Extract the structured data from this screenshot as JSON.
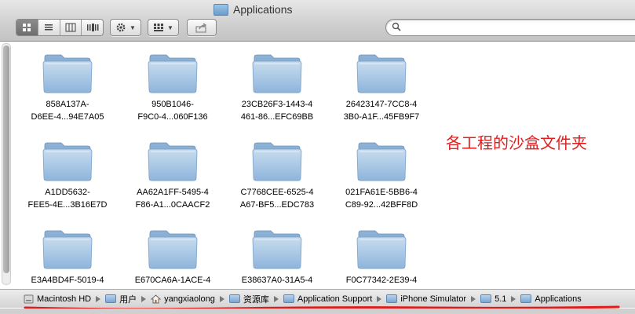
{
  "window": {
    "title": "Applications"
  },
  "toolbar": {
    "view_modes": [
      "icon-view",
      "list-view",
      "column-view",
      "coverflow-view"
    ],
    "active_view": "icon-view"
  },
  "search": {
    "value": "",
    "placeholder": ""
  },
  "folders": [
    {
      "line1": "858A137A-",
      "line2": "D6EE-4...94E7A05"
    },
    {
      "line1": "950B1046-",
      "line2": "F9C0-4...060F136"
    },
    {
      "line1": "23CB26F3-1443-4",
      "line2": "461-86...EFC69BB"
    },
    {
      "line1": "26423147-7CC8-4",
      "line2": "3B0-A1F...45FB9F7"
    },
    {
      "line1": "A1DD5632-",
      "line2": "FEE5-4E...3B16E7D"
    },
    {
      "line1": "AA62A1FF-5495-4",
      "line2": "F86-A1...0CAACF2"
    },
    {
      "line1": "C7768CEE-6525-4",
      "line2": "A67-BF5...EDC783"
    },
    {
      "line1": "021FA61E-5BB6-4",
      "line2": "C89-92...42BFF8D"
    },
    {
      "line1": "E3A4BD4F-5019-4",
      "line2": ""
    },
    {
      "line1": "E670CA6A-1ACE-4",
      "line2": ""
    },
    {
      "line1": "E38637A0-31A5-4",
      "line2": ""
    },
    {
      "line1": "F0C77342-2E39-4",
      "line2": ""
    }
  ],
  "annotation": "各工程的沙盒文件夹",
  "pathbar": [
    {
      "label": "Macintosh HD",
      "icon": "hard-drive-icon"
    },
    {
      "label": "用户",
      "icon": "folder-icon"
    },
    {
      "label": "yangxiaolong",
      "icon": "home-icon"
    },
    {
      "label": "资源库",
      "icon": "folder-icon"
    },
    {
      "label": "Application Support",
      "icon": "folder-icon"
    },
    {
      "label": "iPhone Simulator",
      "icon": "folder-icon"
    },
    {
      "label": "5.1",
      "icon": "folder-icon"
    },
    {
      "label": "Applications",
      "icon": "folder-icon"
    }
  ],
  "colors": {
    "annotation": "#e21c1c",
    "folder_blue": "#8fb8df"
  }
}
